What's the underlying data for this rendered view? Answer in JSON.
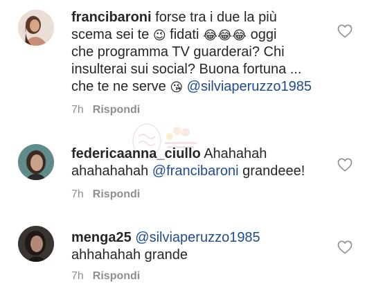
{
  "comments": [
    {
      "username": "francibaroni",
      "lines": [
        [
          "forse tra i due la più"
        ],
        [
          "scema sei te ",
          "😉",
          " fidati ",
          "😂😂😂",
          " oggi"
        ],
        [
          "che programma TV guarderai? Chi"
        ],
        [
          "insulterai sui social? Buona fortuna ..."
        ],
        [
          "che te ne serve ",
          "😘",
          " "
        ]
      ],
      "mention": "@silviaperuzzo1985",
      "time": "7h",
      "reply_label": "Rispondi",
      "avatar_icon": "avatar-photo-brunette"
    },
    {
      "username": "federicaanna_ciullo",
      "text_first": "Ahahahah",
      "text_second_prefix": "ahahahahah ",
      "mention": "@francibaroni",
      "text_second_suffix": " grandeee!",
      "time": "7h",
      "reply_label": "Rispondi",
      "avatar_icon": "avatar-photo-teal"
    },
    {
      "username": "menga25",
      "mention": "@silviaperuzzo1985",
      "text_second": "ahhahahah grande",
      "time": "7h",
      "reply_label": "Rispondi",
      "avatar_icon": "avatar-photo-dark"
    }
  ],
  "like_icon": "heart-outline-icon",
  "colors": {
    "text": "#262626",
    "mention": "#1f4b8f",
    "meta": "#8e8e8e",
    "icon": "#8e8e8e"
  }
}
